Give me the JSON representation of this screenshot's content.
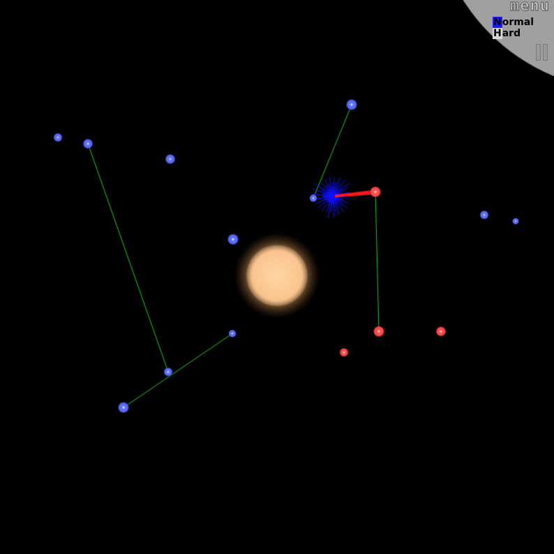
{
  "menu": {
    "title": "menu",
    "options": [
      {
        "label_initial": "N",
        "label_rest": "ormal",
        "selected": true
      },
      {
        "label_initial": "H",
        "label_rest": "ard",
        "selected": false
      }
    ],
    "panel_color": "#a0a0a0",
    "pause_icon": "pause-icon"
  },
  "colors": {
    "background": "#000000",
    "blue_planet": "#5a6bff",
    "red_planet": "#ff4a4a",
    "link_line": "#22cc22",
    "sun_core": "#fbc48f",
    "blue_burst": "#1010ff",
    "red_beam": "#ff1a1a"
  }
}
